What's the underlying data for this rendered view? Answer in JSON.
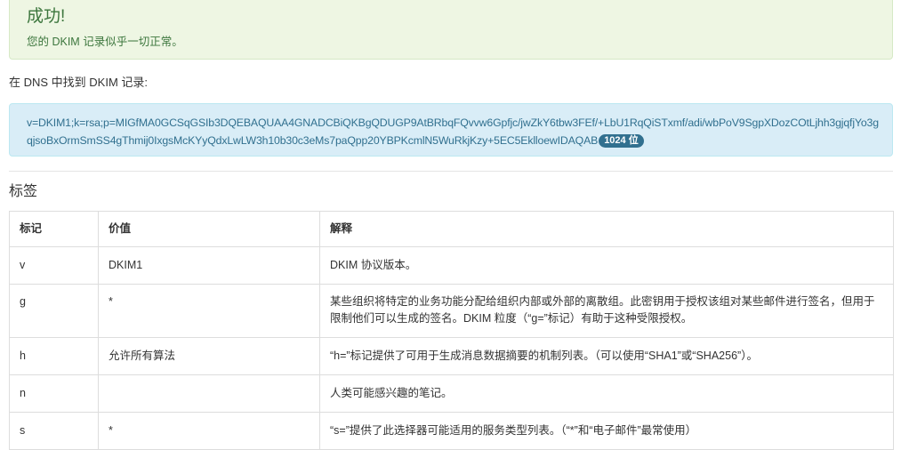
{
  "alert": {
    "title": "成功!",
    "message": "您的 DKIM 记录似乎一切正常。"
  },
  "found_label": "在 DNS 中找到 DKIM 记录:",
  "record": {
    "value": "v=DKIM1;k=rsa;p=MIGfMA0GCSqGSIb3DQEBAQUAA4GNADCBiQKBgQDUGP9AtBRbqFQvvw6Gpfjc/jwZkY6tbw3FEf/+LbU1RqQiSTxmf/adi/wbPoV9SgpXDozCOtLjhh3gjqfjYo3gqjsoBxOrmSmSS4gThmij0IxgsMcKYyQdxLwLW3h10b30c3eMs7paQpp20YBPKcmlN5WuRkjKzy+5EC5EklloewIDAQAB",
    "bits_badge": "1024 位"
  },
  "section_title": "标签",
  "table": {
    "headers": [
      "标记",
      "价值",
      "解释"
    ],
    "rows": [
      {
        "tag": "v",
        "value": "DKIM1",
        "desc": "DKIM 协议版本。"
      },
      {
        "tag": "g",
        "value": "*",
        "desc": "某些组织将特定的业务功能分配给组织内部或外部的离散组。此密钥用于授权该组对某些邮件进行签名，但用于限制他们可以生成的签名。DKIM 粒度（“g=”标记）有助于这种受限授权。"
      },
      {
        "tag": "h",
        "value": "允许所有算法",
        "desc": "“h=”标记提供了可用于生成消息数据摘要的机制列表。（可以使用“SHA1”或“SHA256”）。"
      },
      {
        "tag": "n",
        "value": "",
        "desc": "人类可能感兴趣的笔记。"
      },
      {
        "tag": "s",
        "value": "*",
        "desc": "“s=”提供了此选择器可能适用的服务类型列表。（“*”和“电子邮件”最常使用）"
      }
    ]
  },
  "colors": {
    "success_bg": "#eef6e3",
    "success_text": "#3c763d",
    "info_bg": "#d9edf7",
    "info_text": "#31708f",
    "table_border": "#dddddd"
  }
}
